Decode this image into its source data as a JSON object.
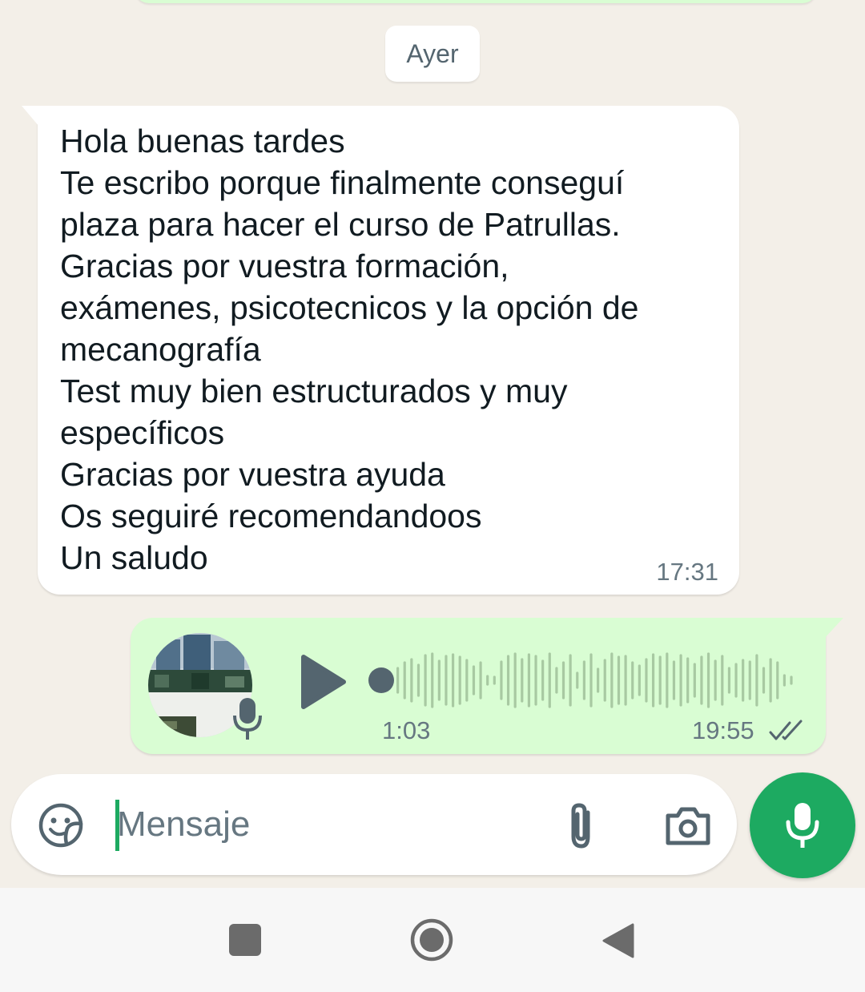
{
  "date_separator": "Ayer",
  "incoming_message": {
    "text": "Hola buenas tardes\nTe escribo porque finalmente conseguí\nplaza para hacer el curso de Patrullas.\nGracias por vuestra formación,\nexámenes, psicotecnicos y la opción de\nmecanografía\nTest muy bien estructurados y muy\nespecíficos\nGracias por vuestra ayuda\nOs seguiré recomendandoos\nUn saludo",
    "time": "17:31"
  },
  "voice_message": {
    "duration": "1:03",
    "time": "19:55",
    "status": "read",
    "progress": 0
  },
  "composer": {
    "placeholder": "Mensaje",
    "value": ""
  },
  "colors": {
    "chat_background": "#f3efe8",
    "incoming_bubble": "#ffffff",
    "outgoing_bubble": "#d9fdd3",
    "accent_green": "#1daa61",
    "secondary_text": "#667781",
    "icon_gray": "#54656f"
  },
  "icons": {
    "composer_left": "sticker-icon",
    "composer_attach": "paperclip-icon",
    "composer_camera": "camera-icon",
    "send_action": "microphone-icon",
    "voice_play": "play-icon",
    "voice_status": "double-check-icon",
    "nav": [
      "recents-icon",
      "home-icon",
      "back-icon"
    ]
  }
}
